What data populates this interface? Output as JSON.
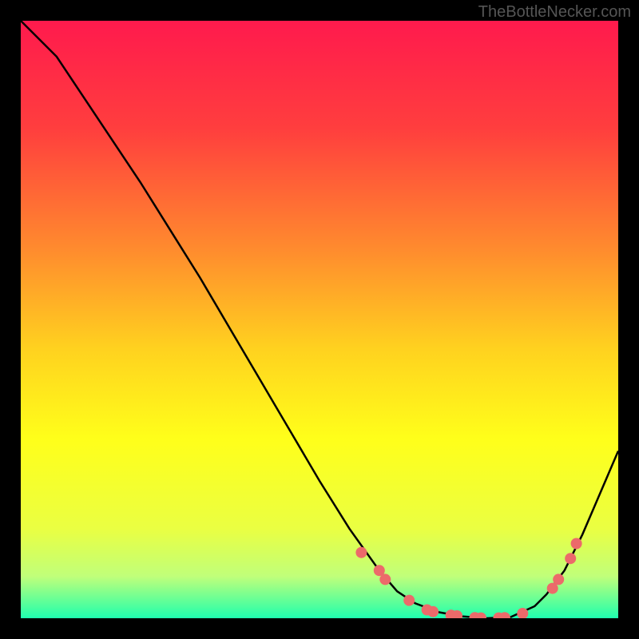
{
  "watermark": "TheBottleNecker.com",
  "chart_data": {
    "type": "line",
    "title": "",
    "xlabel": "",
    "ylabel": "",
    "xlim": [
      0,
      100
    ],
    "ylim": [
      0,
      100
    ],
    "gradient_stops": [
      {
        "offset": 0,
        "color": "#ff1a4d"
      },
      {
        "offset": 0.18,
        "color": "#ff3e3e"
      },
      {
        "offset": 0.38,
        "color": "#ff8a2e"
      },
      {
        "offset": 0.55,
        "color": "#ffd21f"
      },
      {
        "offset": 0.7,
        "color": "#ffff1a"
      },
      {
        "offset": 0.85,
        "color": "#eaff42"
      },
      {
        "offset": 0.93,
        "color": "#c0ff7a"
      },
      {
        "offset": 0.98,
        "color": "#4dff9e"
      },
      {
        "offset": 1.0,
        "color": "#1fffb0"
      }
    ],
    "series": [
      {
        "name": "bottleneck-curve",
        "x": [
          0,
          6,
          10,
          15,
          20,
          25,
          30,
          35,
          40,
          45,
          50,
          55,
          60,
          63,
          66,
          70,
          74,
          78,
          82,
          86,
          88,
          91,
          94,
          97,
          100
        ],
        "y": [
          100,
          94,
          88,
          80.5,
          73,
          65,
          57,
          48.5,
          40,
          31.5,
          23,
          15,
          8,
          4.5,
          2.5,
          1,
          0.3,
          0,
          0.2,
          2,
          4,
          8,
          14,
          21,
          28
        ]
      }
    ],
    "markers": {
      "name": "highlight-points",
      "color": "#ec6a6a",
      "radius": 7,
      "points": [
        {
          "x": 57,
          "y": 11
        },
        {
          "x": 60,
          "y": 8
        },
        {
          "x": 61,
          "y": 6.5
        },
        {
          "x": 65,
          "y": 3
        },
        {
          "x": 68,
          "y": 1.4
        },
        {
          "x": 69,
          "y": 1.1
        },
        {
          "x": 72,
          "y": 0.5
        },
        {
          "x": 73,
          "y": 0.4
        },
        {
          "x": 76,
          "y": 0.1
        },
        {
          "x": 77,
          "y": 0.05
        },
        {
          "x": 80,
          "y": 0.05
        },
        {
          "x": 81,
          "y": 0.1
        },
        {
          "x": 84,
          "y": 0.8
        },
        {
          "x": 89,
          "y": 5
        },
        {
          "x": 90,
          "y": 6.5
        },
        {
          "x": 92,
          "y": 10
        },
        {
          "x": 93,
          "y": 12.5
        }
      ]
    }
  }
}
